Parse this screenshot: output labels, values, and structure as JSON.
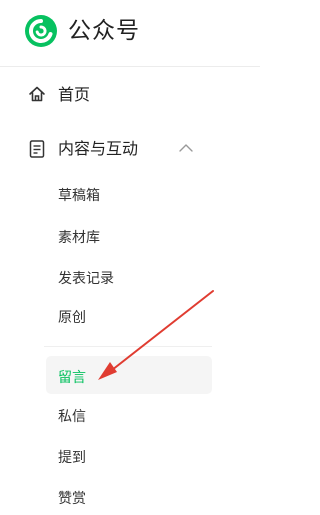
{
  "header": {
    "brand": "公众号",
    "logo_icon": "wechat-official-account-logo",
    "brand_color": "#07c160"
  },
  "nav": {
    "home": {
      "label": "首页",
      "icon": "home-icon"
    },
    "content": {
      "label": "内容与互动",
      "icon": "document-icon",
      "expanded": true,
      "items": [
        {
          "label": "草稿箱"
        },
        {
          "label": "素材库"
        },
        {
          "label": "发表记录"
        },
        {
          "label": "原创"
        },
        {
          "label": "留言",
          "active": true
        },
        {
          "label": "私信"
        },
        {
          "label": "提到"
        },
        {
          "label": "赞赏"
        }
      ]
    }
  },
  "colors": {
    "accent": "#07c160",
    "annotation_arrow": "#e03c31",
    "active_bg": "#f5f5f5"
  }
}
